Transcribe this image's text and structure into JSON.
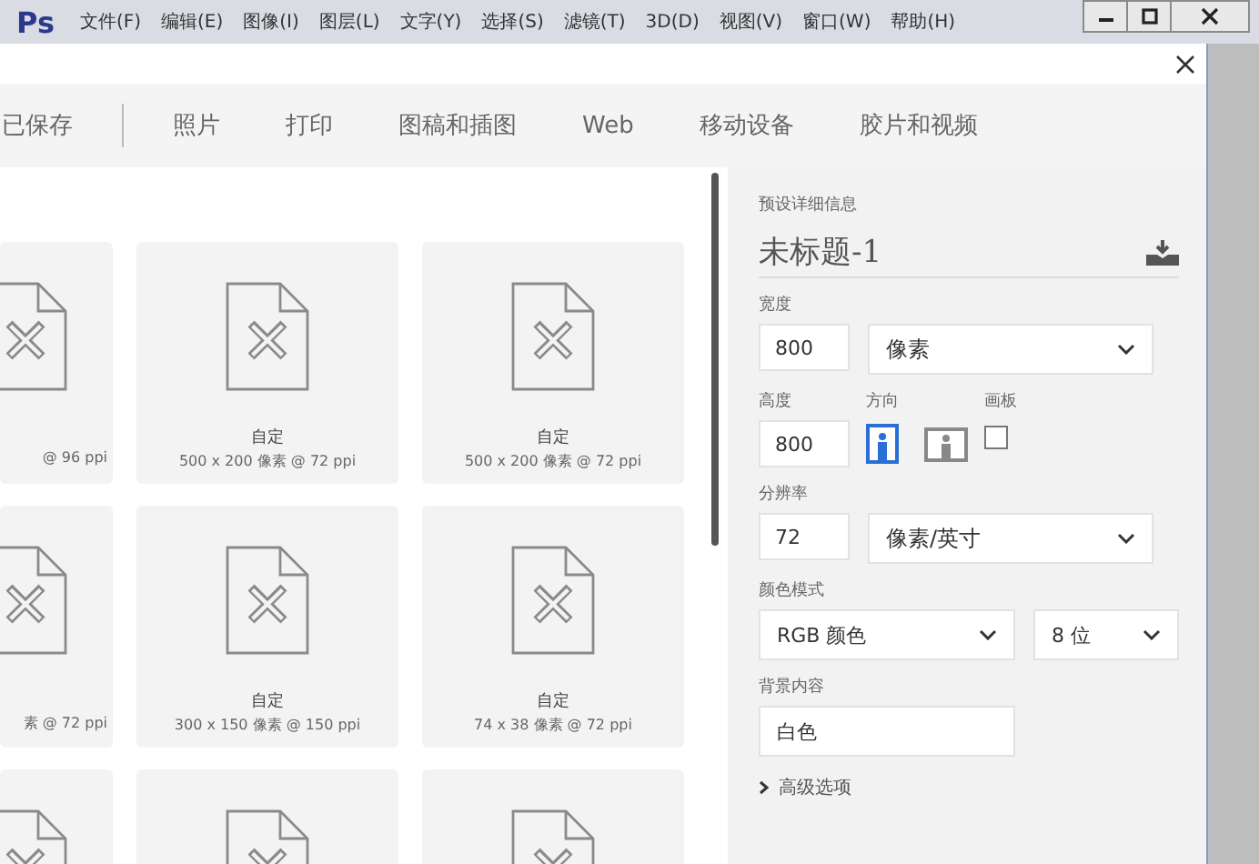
{
  "app_bar": {
    "logo": "Ps",
    "menu": [
      "文件(F)",
      "编辑(E)",
      "图像(I)",
      "图层(L)",
      "文字(Y)",
      "选择(S)",
      "滤镜(T)",
      "3D(D)",
      "视图(V)",
      "窗口(W)",
      "帮助(H)"
    ]
  },
  "tabs": [
    {
      "label": "已保存",
      "selected": false
    },
    {
      "label": "照片",
      "selected": false
    },
    {
      "label": "打印",
      "selected": false
    },
    {
      "label": "图稿和插图",
      "selected": false
    },
    {
      "label": "Web",
      "selected": false
    },
    {
      "label": "移动设备",
      "selected": false
    },
    {
      "label": "胶片和视频",
      "selected": false
    }
  ],
  "presets": [
    [
      {
        "kind": "partial",
        "detail": "@ 96 ppi"
      },
      {
        "kind": "full",
        "title": "自定",
        "detail": "500 x 200 像素 @ 72 ppi"
      },
      {
        "kind": "full",
        "title": "自定",
        "detail": "500 x 200 像素 @ 72 ppi"
      }
    ],
    [
      {
        "kind": "partial",
        "detail": "素 @ 72 ppi"
      },
      {
        "kind": "full",
        "title": "自定",
        "detail": "300 x 150 像素 @ 150 ppi"
      },
      {
        "kind": "full",
        "title": "自定",
        "detail": "74 x 38 像素 @ 72 ppi"
      }
    ],
    [
      {
        "kind": "partial"
      },
      {
        "kind": "full"
      },
      {
        "kind": "full"
      }
    ]
  ],
  "details": {
    "heading": "预设详细信息",
    "name": "未标题-1",
    "width": {
      "label": "宽度",
      "value": "800",
      "unit": "像素"
    },
    "height": {
      "label": "高度",
      "value": "800"
    },
    "orientation": {
      "label": "方向",
      "options": [
        {
          "kind": "portrait",
          "selected": true
        },
        {
          "kind": "landscape",
          "selected": false
        }
      ]
    },
    "artboard": {
      "label": "画板",
      "checked": false
    },
    "resolution": {
      "label": "分辨率",
      "value": "72",
      "unit": "像素/英寸"
    },
    "color_mode": {
      "label": "颜色模式",
      "mode": "RGB 颜色",
      "depth": "8 位"
    },
    "background": {
      "label": "背景内容",
      "value": "白色"
    },
    "advanced": "高级选项"
  }
}
